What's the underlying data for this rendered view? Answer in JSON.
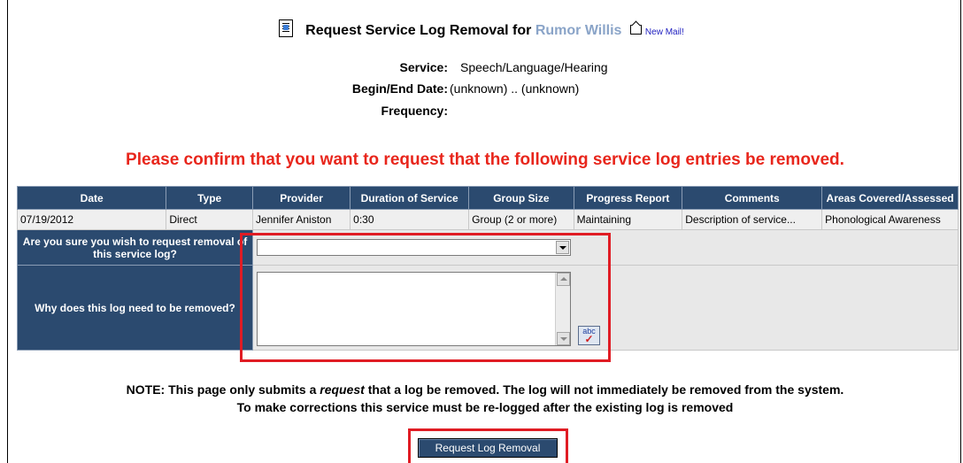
{
  "header": {
    "title_prefix": "Request Service Log Removal for",
    "student_name": "Rumor Willis",
    "new_mail": "New Mail!"
  },
  "info": {
    "service_label": "Service:",
    "service_value": "Speech/Language/Hearing",
    "dates_label": "Begin/End Date:",
    "dates_value": "(unknown) .. (unknown)",
    "frequency_label": "Frequency:",
    "frequency_value": ""
  },
  "confirm_message": "Please confirm that you want to request that the following service log entries be removed.",
  "table": {
    "columns": [
      "Date",
      "Type",
      "Provider",
      "Duration of Service",
      "Group Size",
      "Progress Report",
      "Comments",
      "Areas Covered/Assessed"
    ],
    "rows": [
      [
        "07/19/2012",
        "Direct",
        "Jennifer Aniston",
        "0:30",
        "Group (2 or more)",
        "Maintaining",
        "Description of service...",
        "Phonological Awareness"
      ]
    ]
  },
  "form": {
    "confirm_question": "Are you sure you wish to request removal of this service log?",
    "confirm_selected": "",
    "reason_question": "Why does this log need to be removed?",
    "reason_value": "",
    "spellcheck_label": "abc"
  },
  "note": {
    "line1_before": "NOTE: This page only submits a ",
    "line1_em": "request",
    "line1_after": " that a log be removed. The log will not immediately be removed from the system.",
    "line2": "To make corrections this service must be re-logged after the existing log is removed"
  },
  "submit_label": "Request Log Removal",
  "colors": {
    "header_bg": "#2b4a6f",
    "accent_red": "#e8261c",
    "student_name": "#8aa4c8"
  }
}
